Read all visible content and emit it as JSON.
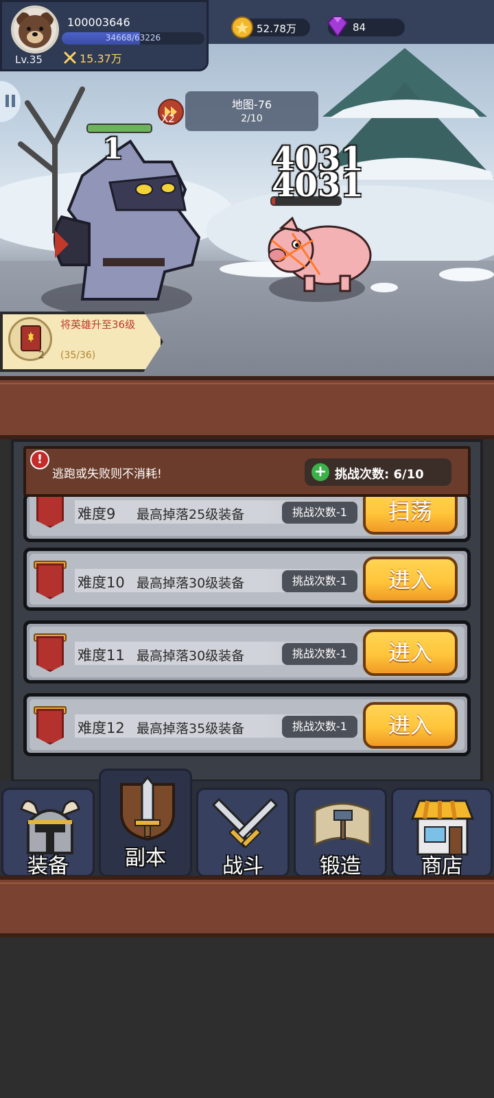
{
  "player": {
    "id": "100003646",
    "level": "Lv.35",
    "exp_text": "34668/63226",
    "exp_fraction": 0.548,
    "power": "15.37万"
  },
  "currency": {
    "gold": "52.78万",
    "gems": "84"
  },
  "stage": {
    "name": "地图-76",
    "progress": "2/10",
    "speed": "X2"
  },
  "combat": {
    "hero_hit": "1",
    "hero_hp_fraction": 1.0,
    "enemy_damage": [
      "4031",
      "4031"
    ],
    "enemy_hp_fraction": 0.05
  },
  "quest": {
    "title": "将英雄升至36级",
    "progress": "(35/36)",
    "reward_count": "2"
  },
  "dungeon": {
    "notice": "逃跑或失败则不消耗!",
    "attempts": "挑战次数: 6/10",
    "rows": [
      {
        "name": "难度9",
        "drop": "最高掉落25级装备",
        "cost": "挑战次数-1",
        "button": "扫荡"
      },
      {
        "name": "难度10",
        "drop": "最高掉落30级装备",
        "cost": "挑战次数-1",
        "button": "进入"
      },
      {
        "name": "难度11",
        "drop": "最高掉落30级装备",
        "cost": "挑战次数-1",
        "button": "进入"
      },
      {
        "name": "难度12",
        "drop": "最高掉落35级装备",
        "cost": "挑战次数-1",
        "button": "进入"
      }
    ]
  },
  "nav": {
    "tabs": [
      {
        "label": "装备",
        "icon": "helmet-icon"
      },
      {
        "label": "副本",
        "icon": "sword-shield-icon"
      },
      {
        "label": "战斗",
        "icon": "crossed-swords-icon"
      },
      {
        "label": "锻造",
        "icon": "scroll-hammer-icon"
      },
      {
        "label": "商店",
        "icon": "shop-icon"
      }
    ],
    "active_index": 1
  },
  "colors": {
    "button_yellow": "#ffc53a",
    "wood": "#7a4331",
    "nav_bg": "#384060",
    "quest_red": "#c0392b"
  }
}
